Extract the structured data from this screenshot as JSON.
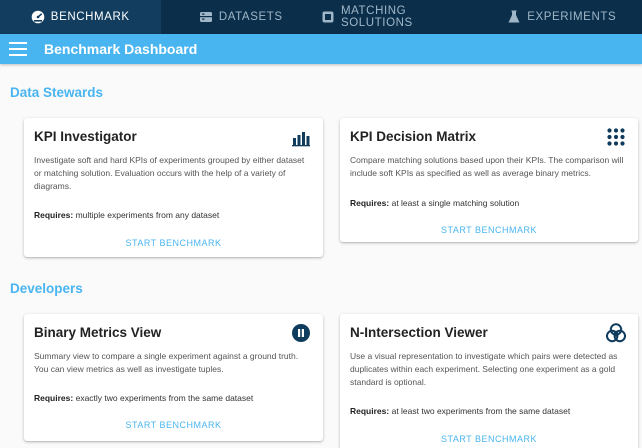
{
  "topnav": {
    "tabs": [
      {
        "label": "BENCHMARK",
        "icon": "speedometer-icon",
        "active": true
      },
      {
        "label": "DATASETS",
        "icon": "database-icon",
        "active": false
      },
      {
        "label": "MATCHING SOLUTIONS",
        "icon": "app-box-icon",
        "active": false
      },
      {
        "label": "EXPERIMENTS",
        "icon": "flask-icon",
        "active": false
      }
    ]
  },
  "appbar": {
    "title": "Benchmark Dashboard",
    "menu_icon": "hamburger-menu-icon"
  },
  "sections": [
    {
      "title": "Data Stewards"
    },
    {
      "title": "Developers"
    }
  ],
  "cards": [
    {
      "title": "KPI Investigator",
      "icon": "bar-chart-icon",
      "description": "Investigate soft and hard KPIs of experiments grouped by either dataset or matching solution. Evaluation occurs with the help of a variety of diagrams.",
      "requires_label": "Requires:",
      "requires_text": "multiple experiments from any dataset",
      "button": "START BENCHMARK"
    },
    {
      "title": "KPI Decision Matrix",
      "icon": "dot-grid-icon",
      "description": "Compare matching solutions based upon their KPIs. The comparison will include soft KPIs as specified as well as average binary metrics.",
      "requires_label": "Requires:",
      "requires_text": "at least a single matching solution",
      "button": "START BENCHMARK"
    },
    {
      "title": "Binary Metrics View",
      "icon": "pause-circle-icon",
      "description": "Summary view to compare a single experiment against a ground truth. You can view metrics as well as investigate tuples.",
      "requires_label": "Requires:",
      "requires_text": "exactly two experiments from the same dataset",
      "button": "START BENCHMARK"
    },
    {
      "title": "N-Intersection Viewer",
      "icon": "venn-diagram-icon",
      "description": "Use a visual representation to investigate which pairs were detected as duplicates within each experiment. Selecting one experiment as a gold standard is optional.",
      "requires_label": "Requires:",
      "requires_text": "at least two experiments from the same dataset",
      "button": "START BENCHMARK"
    }
  ],
  "colors": {
    "nav_bg": "#0b2f4a",
    "accent": "#49b5f0",
    "icon_navy": "#0f3b5c"
  }
}
